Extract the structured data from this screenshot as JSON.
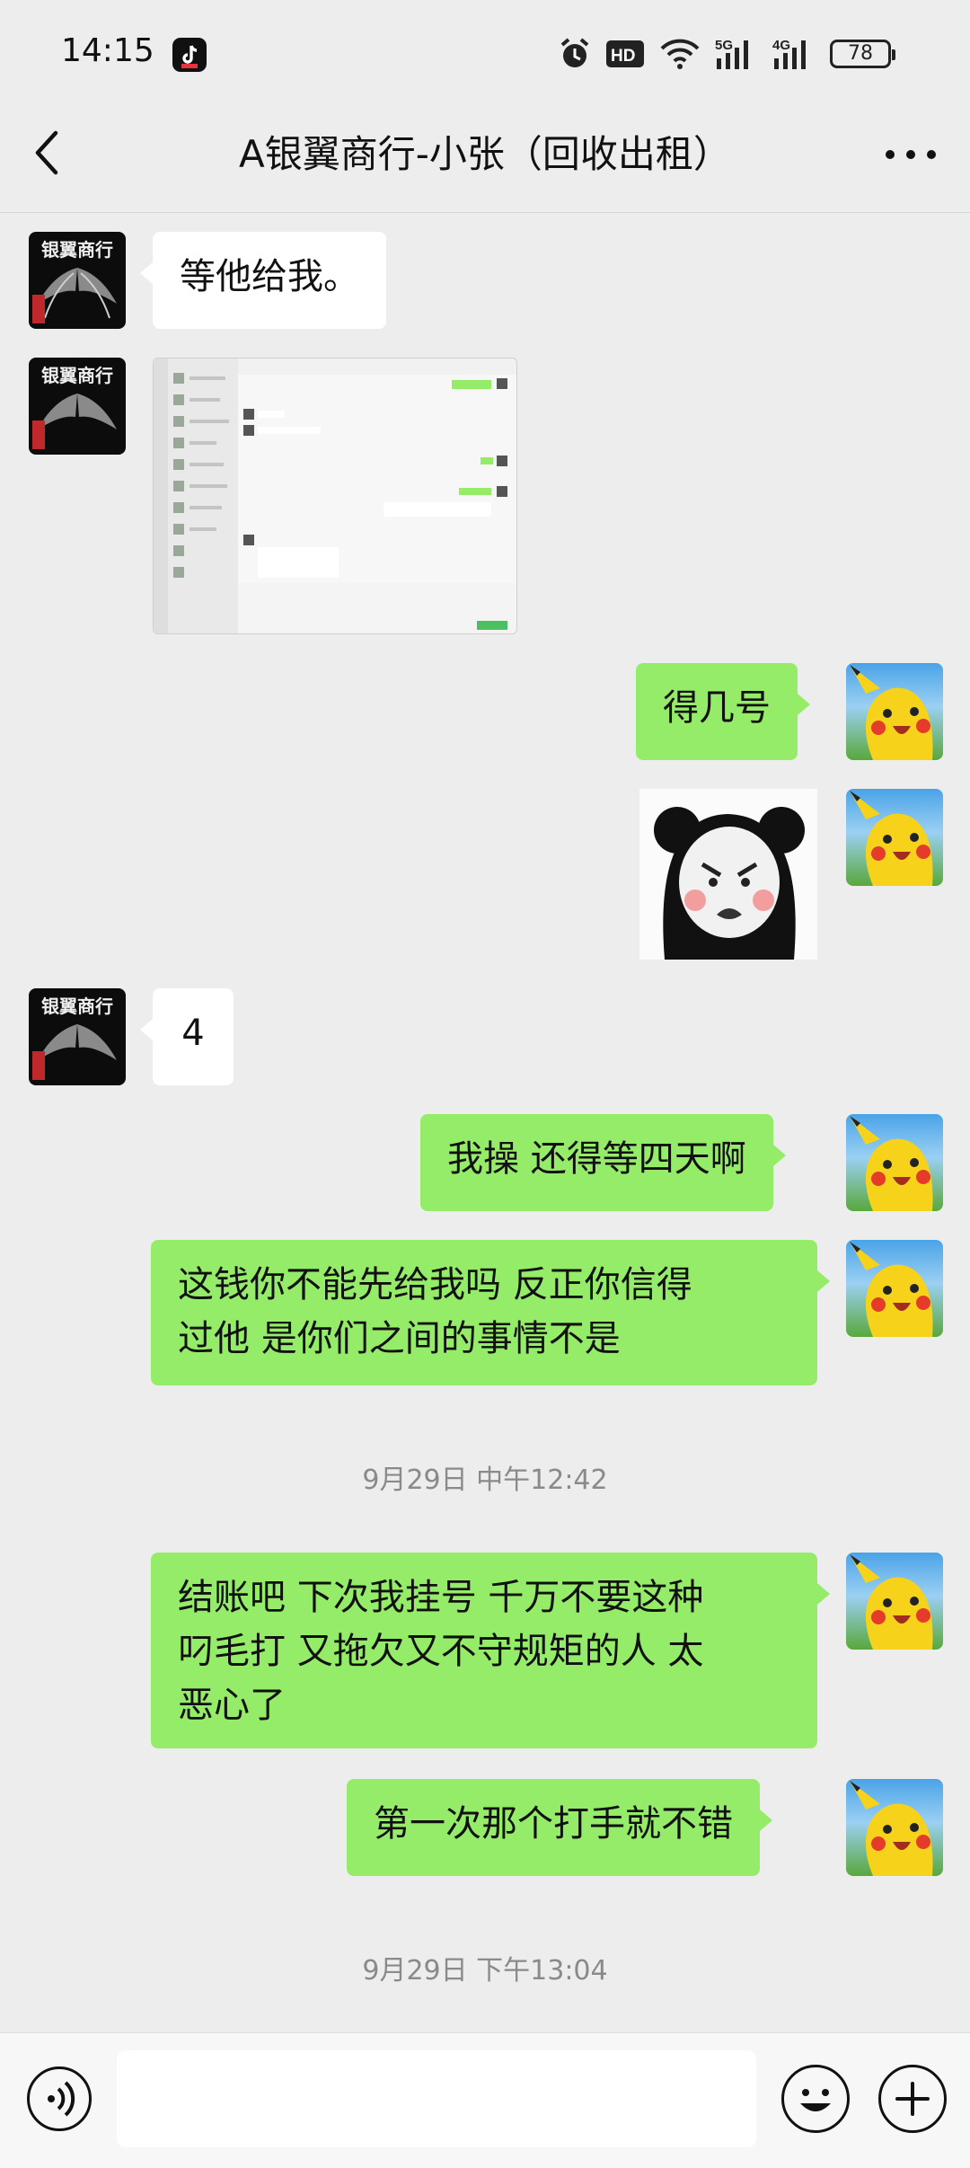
{
  "status_bar": {
    "time": "14:15",
    "battery": "78",
    "icons": [
      "tiktok-icon",
      "alarm-icon",
      "hd-icon",
      "wifi-icon",
      "5g-signal-icon",
      "4g-signal-icon",
      "battery-icon"
    ]
  },
  "header": {
    "title": "A银翼商行-小张（回收出租）",
    "back_icon": "chevron-left-icon",
    "more_icon": "more-dots-icon"
  },
  "contact_avatar": {
    "text": "银翼商行"
  },
  "messages": [
    {
      "side": "left",
      "type": "text",
      "text": "等他给我。"
    },
    {
      "side": "left",
      "type": "image",
      "image": "chat-screenshot"
    },
    {
      "side": "right",
      "type": "text",
      "text": "得几号"
    },
    {
      "side": "right",
      "type": "sticker",
      "image": "panda-meme-sticker"
    },
    {
      "side": "left",
      "type": "text",
      "text": "4"
    },
    {
      "side": "right",
      "type": "text",
      "text": "我操 还得等四天啊"
    },
    {
      "side": "right",
      "type": "text",
      "line1": "这钱你不能先给我吗  反正你信得",
      "line2": "过他  是你们之间的事情不是"
    },
    {
      "type": "timestamp",
      "text": "9月29日 中午12:42"
    },
    {
      "side": "right",
      "type": "text",
      "line1": "结账吧  下次我挂号 千万不要这种",
      "line2": "叼毛打 又拖欠又不守规矩的人   太",
      "line3": "恶心了"
    },
    {
      "side": "right",
      "type": "text",
      "text": "第一次那个打手就不错"
    },
    {
      "type": "timestamp",
      "text": "9月29日 下午13:04"
    }
  ],
  "input_bar": {
    "voice_icon": "voice-icon",
    "input_value": "",
    "emoji_icon": "emoji-icon",
    "plus_icon": "plus-icon"
  },
  "colors": {
    "background": "#ededed",
    "bubble_self": "#95ec69",
    "bubble_other": "#ffffff",
    "timestamp": "#8a8a8a"
  }
}
